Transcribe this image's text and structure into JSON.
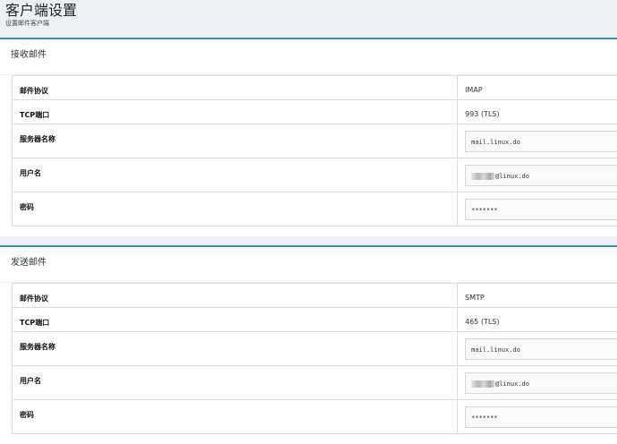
{
  "page": {
    "title": "客户端设置",
    "subtitle": "设置邮件客户端"
  },
  "incoming": {
    "title": "接收邮件",
    "protocol_label": "邮件协议",
    "protocol_value": "IMAP",
    "port_label": "TCP端口",
    "port_value": "993 (TLS)",
    "server_label": "服务器名称",
    "server_value": "mail.linux.do",
    "username_label": "用户名",
    "username_suffix": "@linux.do",
    "password_label": "密码",
    "password_value": "*******"
  },
  "outgoing": {
    "title": "发送邮件",
    "protocol_label": "邮件协议",
    "protocol_value": "SMTP",
    "port_label": "TCP端口",
    "port_value": "465 (TLS)",
    "server_label": "服务器名称",
    "server_value": "mail.linux.do",
    "username_label": "用户名",
    "username_suffix": "@linux.do",
    "password_label": "密码",
    "password_value": "*******"
  },
  "colors": {
    "accent": "#3c8dbc",
    "background": "#ecf0f5"
  }
}
